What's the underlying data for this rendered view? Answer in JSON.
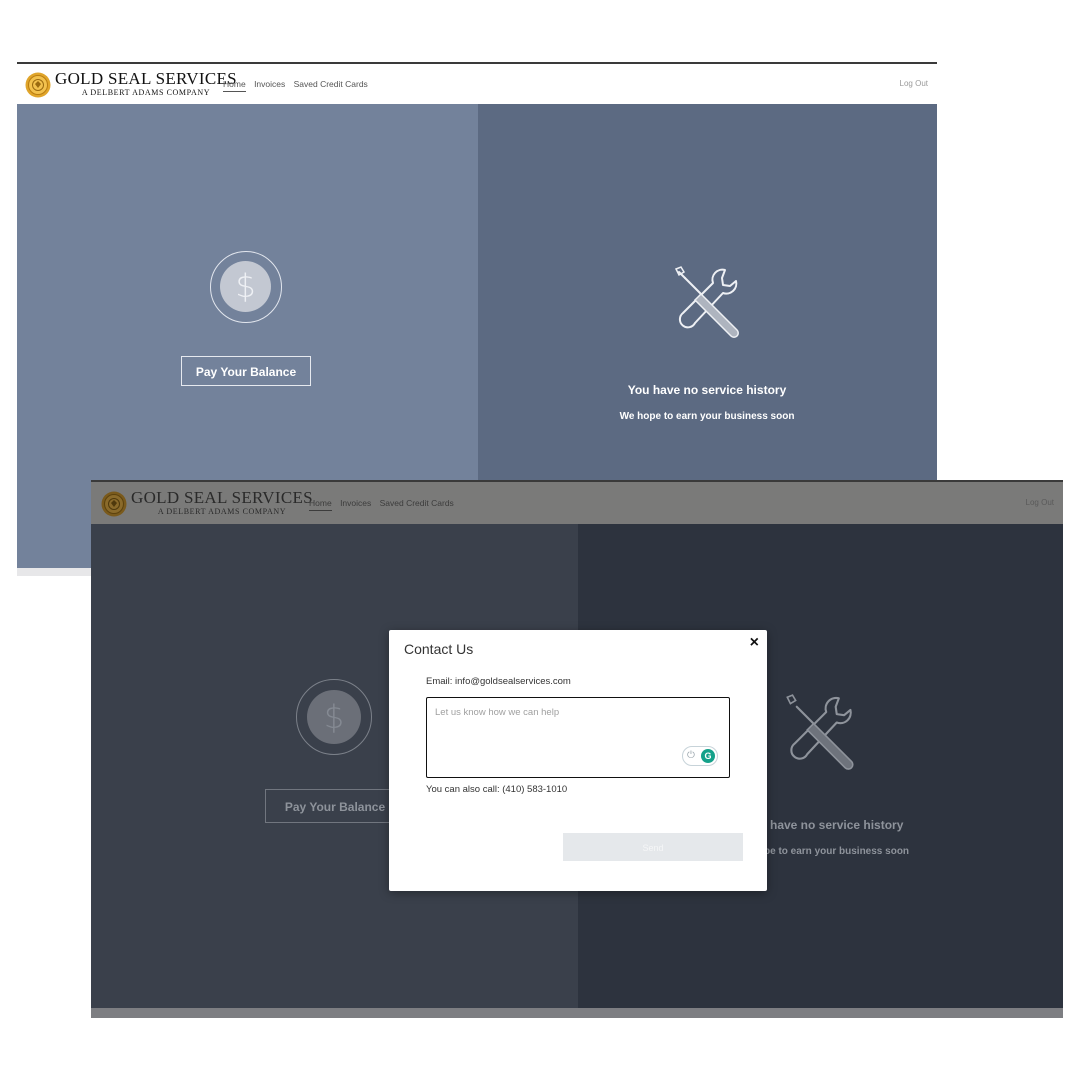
{
  "brand": {
    "name": "GOLD SEAL SERVICES",
    "tagline": "A DELBERT ADAMS COMPANY"
  },
  "nav": {
    "items": [
      {
        "label": "Home",
        "active": true
      },
      {
        "label": "Invoices",
        "active": false
      },
      {
        "label": "Saved Credit Cards",
        "active": false
      }
    ],
    "logout_label": "Log Out"
  },
  "home": {
    "currency_symbol": "$",
    "pay_button_label": "Pay Your Balance",
    "no_history_title": "You have no service history",
    "no_history_subtitle": "We hope to earn your business soon"
  },
  "dimmed_home": {
    "no_history_title": "have no service history",
    "no_history_subtitle": "pe to earn your business soon"
  },
  "modal": {
    "title": "Contact Us",
    "close_symbol": "×",
    "email_line": "Email: info@goldsealservices.com",
    "message_placeholder": "Let us know how we can help",
    "message_value": "",
    "phone_line": "You can also call: (410) 583-1010",
    "send_label": "Send"
  },
  "colors": {
    "panel_left": "#73829b",
    "panel_right": "#5c6a82",
    "overlay_left": "#3a404b",
    "overlay_right": "#2d333e",
    "grammarly_green": "#15a18a"
  },
  "icons": [
    "gold-seal-logo-icon",
    "dollar-coin-icon",
    "wrench-screwdriver-icon",
    "close-icon",
    "power-icon",
    "grammarly-icon"
  ]
}
